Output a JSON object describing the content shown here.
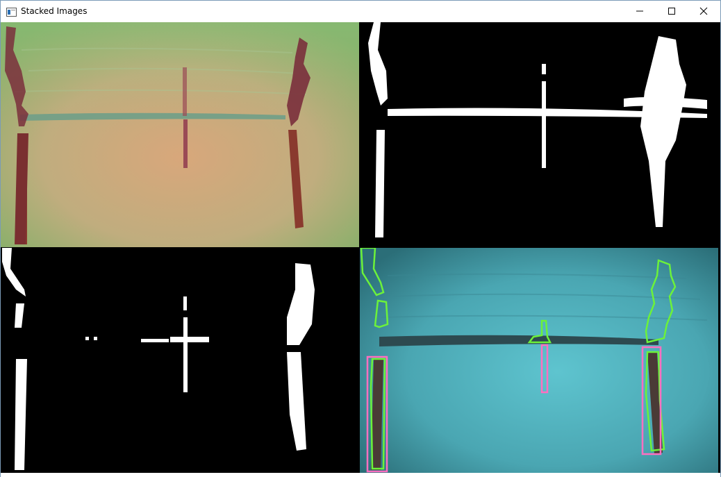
{
  "window": {
    "title": "Stacked Images",
    "icons": {
      "app": "app-window-icon",
      "minimize": "minimize-icon",
      "maximize": "maximize-icon",
      "close": "close-icon"
    }
  },
  "panels": [
    {
      "name": "original-image",
      "colors": {
        "background": "#c9a878",
        "accent": "#7a2a3e"
      }
    },
    {
      "name": "binary-mask-1",
      "colors": {
        "background": "#000000",
        "foreground": "#ffffff"
      }
    },
    {
      "name": "binary-mask-2",
      "colors": {
        "background": "#000000",
        "foreground": "#ffffff"
      }
    },
    {
      "name": "contour-overlay",
      "colors": {
        "background": "#4fb0bc",
        "contour": "#6cf23a",
        "bbox": "#ff6fc0"
      }
    }
  ]
}
